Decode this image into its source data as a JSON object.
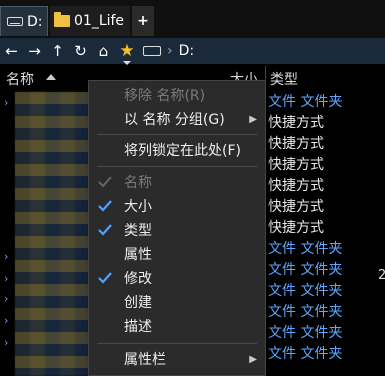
{
  "tabs": [
    {
      "label": "D:",
      "icon": "drive-icon"
    },
    {
      "label": "01_Life",
      "icon": "folder-icon"
    },
    {
      "label": "+",
      "icon": "new-tab"
    }
  ],
  "nav": {
    "back": "←",
    "forward": "→",
    "up": "↑",
    "refresh": "↻",
    "home": "⌂",
    "favorites": "★",
    "separator": "›",
    "path": "D:"
  },
  "columns": {
    "name": "名称",
    "size": "大小",
    "type": "类型"
  },
  "type_rows": [
    {
      "text": "文件 文件夹",
      "kind": "folder"
    },
    {
      "text": "快捷方式",
      "kind": "shortcut"
    },
    {
      "text": "快捷方式",
      "kind": "shortcut"
    },
    {
      "text": "快捷方式",
      "kind": "shortcut"
    },
    {
      "text": "快捷方式",
      "kind": "shortcut"
    },
    {
      "text": "快捷方式",
      "kind": "shortcut"
    },
    {
      "text": "快捷方式",
      "kind": "shortcut"
    },
    {
      "text": "文件 文件夹",
      "kind": "folder"
    },
    {
      "text": "文件 文件夹",
      "kind": "folder"
    },
    {
      "text": "文件 文件夹",
      "kind": "folder"
    },
    {
      "text": "文件 文件夹",
      "kind": "folder"
    },
    {
      "text": "文件 文件夹",
      "kind": "folder"
    },
    {
      "text": "文件 文件夹",
      "kind": "folder"
    }
  ],
  "edge_char": "2",
  "menu": {
    "remove": "移除 名称(R)",
    "group_by": "以 名称 分组(G)",
    "lock": "将列锁定在此处(F)",
    "col_name": "名称",
    "col_size": "大小",
    "col_type": "类型",
    "col_attr": "属性",
    "col_modified": "修改",
    "col_created": "创建",
    "col_desc": "描述",
    "columns_bar": "属性栏",
    "submenu_arrow": "▶"
  }
}
